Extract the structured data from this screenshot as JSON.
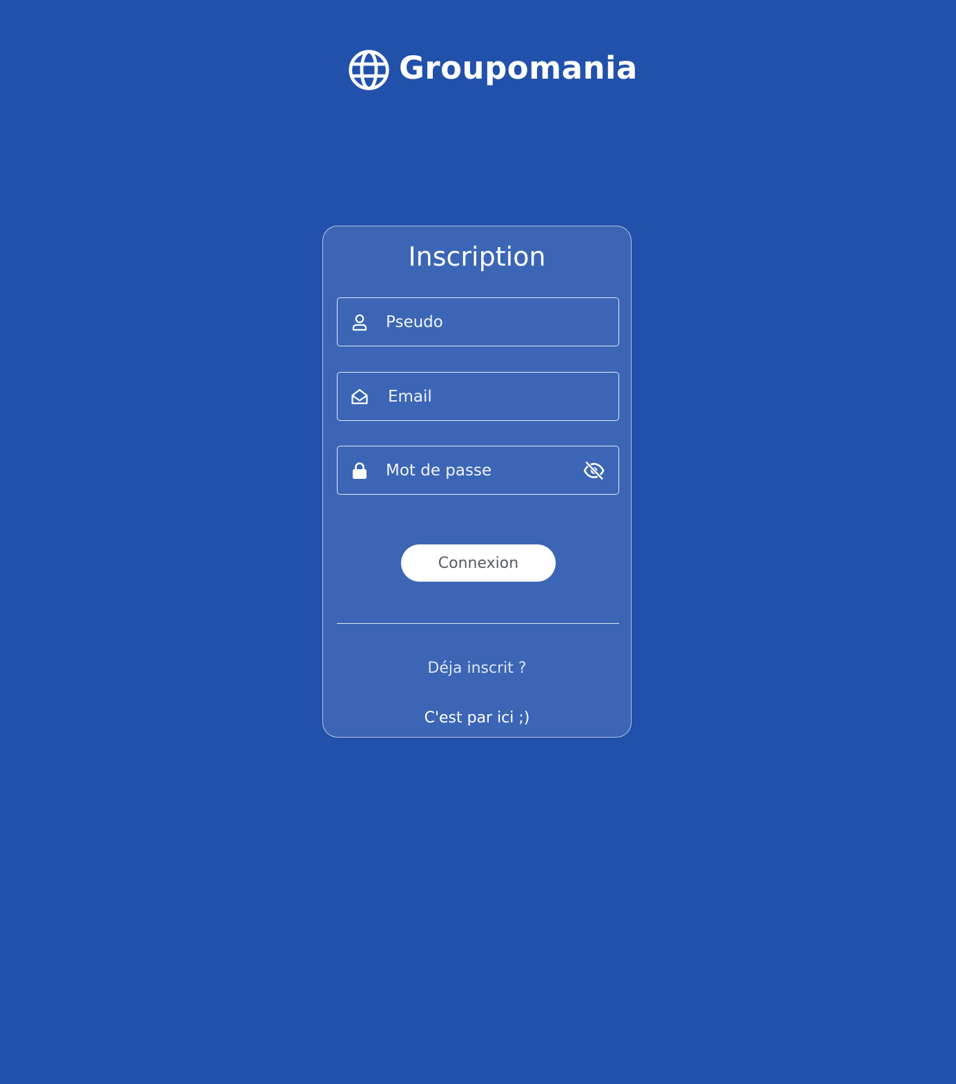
{
  "brand": {
    "name": "Groupomania",
    "icon": "globe-icon"
  },
  "form": {
    "title": "Inscription",
    "pseudo": {
      "placeholder": "Pseudo",
      "value": "",
      "icon": "user-icon"
    },
    "email": {
      "placeholder": "Email",
      "value": "",
      "icon": "envelope-open-icon"
    },
    "password": {
      "placeholder": "Mot de passe",
      "value": "",
      "icon": "lock-icon",
      "toggle_icon": "eye-slash-icon"
    },
    "submit_label": "Connexion",
    "already_registered": "Déja inscrit ?",
    "login_link": "C'est par ici ;)"
  },
  "colors": {
    "background": "#2251ab",
    "card": "rgba(255,255,255,0.12)",
    "button_text": "#555a66"
  }
}
